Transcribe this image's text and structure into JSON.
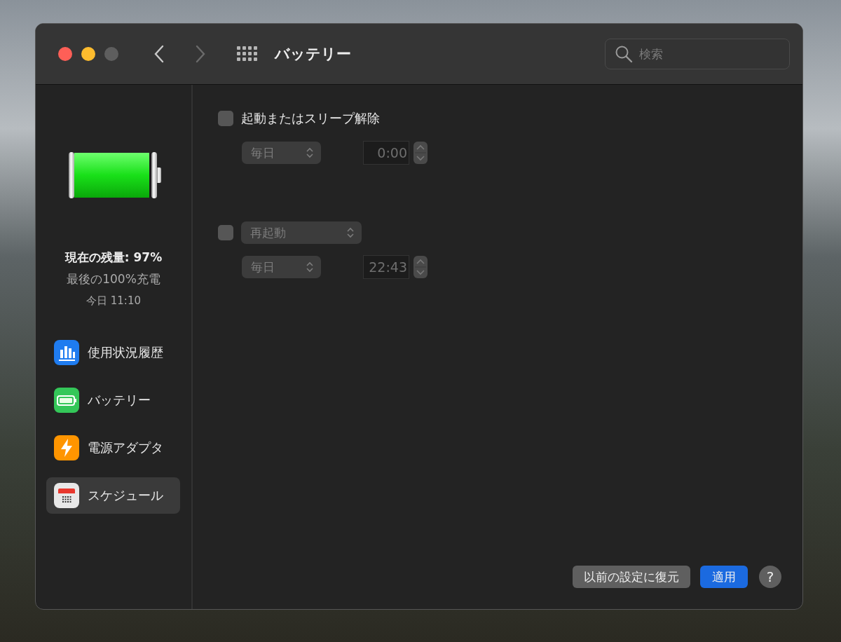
{
  "window": {
    "title": "バッテリー",
    "search": {
      "placeholder": "検索"
    }
  },
  "sidebar": {
    "battery": {
      "level": 0.97
    },
    "charge_level": "現在の残量: 97%",
    "last_full_charge": "最後の100%充電",
    "last_full_charge_time": "今日 11:10",
    "items": [
      {
        "label": "使用状況履歴",
        "kind": "usage",
        "selected": false
      },
      {
        "label": "バッテリー",
        "kind": "battery",
        "selected": false
      },
      {
        "label": "電源アダプタ",
        "kind": "adapter",
        "selected": false
      },
      {
        "label": "スケジュール",
        "kind": "schedule",
        "selected": true
      }
    ]
  },
  "schedule": [
    {
      "kind": "label",
      "checked": false,
      "label": "起動またはスリープ解除",
      "repeat": "毎日",
      "time": "0:00"
    },
    {
      "kind": "popup",
      "checked": false,
      "action": "再起動",
      "repeat": "毎日",
      "time": "22:43"
    }
  ],
  "buttons": {
    "revert": "以前の設定に復元",
    "apply": "適用",
    "help": "?"
  }
}
